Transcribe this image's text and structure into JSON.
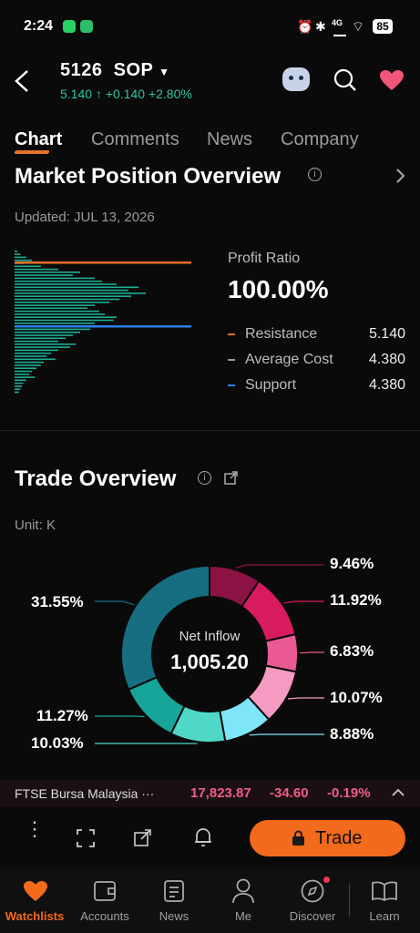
{
  "status": {
    "time": "2:24",
    "network": "4G",
    "battery": "85"
  },
  "header": {
    "code": "5126",
    "name": "SOP",
    "price": "5.140",
    "arrow": "↑",
    "change": "+0.140",
    "change_pct": "+2.80%"
  },
  "tabs": [
    "Chart",
    "Comments",
    "News",
    "Company"
  ],
  "market_position": {
    "title": "Market Position Overview",
    "updated": "Updated: JUL 13, 2026",
    "profit_ratio_label": "Profit Ratio",
    "profit_ratio": "100.00%",
    "legend": [
      {
        "label": "Resistance",
        "value": "5.140",
        "color": "#e8702a"
      },
      {
        "label": "Average Cost",
        "value": "4.380",
        "color": "#9a9a9a"
      },
      {
        "label": "Support",
        "value": "4.380",
        "color": "#2f80ed"
      }
    ],
    "histogram_levels": [
      0.02,
      0.04,
      0.08,
      0.12,
      0.06,
      0.18,
      0.3,
      0.45,
      0.4,
      0.55,
      0.6,
      0.7,
      0.85,
      0.78,
      0.9,
      0.8,
      0.72,
      0.65,
      0.55,
      0.5,
      0.58,
      0.62,
      0.7,
      0.68,
      0.55,
      0.48,
      0.52,
      0.45,
      0.4,
      0.35,
      0.3,
      0.42,
      0.38,
      0.3,
      0.25,
      0.22,
      0.28,
      0.2,
      0.18,
      0.15,
      0.12,
      0.1,
      0.14,
      0.08,
      0.06,
      0.05,
      0.04,
      0.03
    ]
  },
  "trade_overview": {
    "title": "Trade Overview",
    "unit": "Unit: K",
    "center_label": "Net Inflow",
    "center_value": "1,005.20",
    "slices": [
      {
        "pct": "9.46%",
        "value": 9.46,
        "color": "#8c1244"
      },
      {
        "pct": "11.92%",
        "value": 11.92,
        "color": "#d81b60"
      },
      {
        "pct": "6.83%",
        "value": 6.83,
        "color": "#ec5a95"
      },
      {
        "pct": "10.07%",
        "value": 10.07,
        "color": "#f59ac0"
      },
      {
        "pct": "8.88%",
        "value": 8.88,
        "color": "#7ee6f8"
      },
      {
        "pct": "10.03%",
        "value": 10.03,
        "color": "#4fd8c8"
      },
      {
        "pct": "11.27%",
        "value": 11.27,
        "color": "#17a59a"
      },
      {
        "pct": "31.55%",
        "value": 31.55,
        "color": "#166e80"
      }
    ]
  },
  "ticker": {
    "name": "FTSE Bursa Malaysia ···",
    "value": "17,823.87",
    "change": "-34.60",
    "pct": "-0.19%"
  },
  "toolbar": {
    "trade_label": "Trade"
  },
  "nav": [
    "Watchlists",
    "Accounts",
    "News",
    "Me",
    "Discover",
    "Learn"
  ]
}
